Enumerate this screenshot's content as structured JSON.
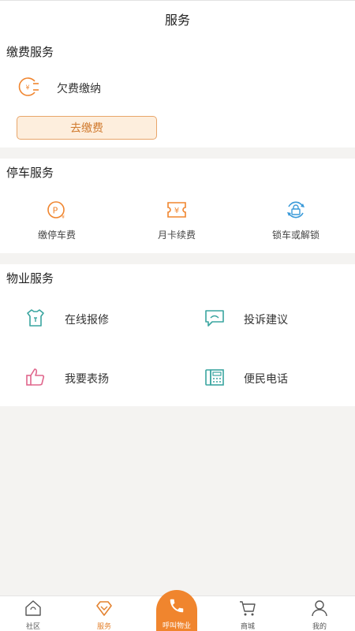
{
  "header": {
    "title": "服务"
  },
  "payment": {
    "title": "缴费服务",
    "arrears_label": "欠费缴纳",
    "pay_button": "去缴费"
  },
  "parking": {
    "title": "停车服务",
    "items": [
      {
        "label": "缴停车费",
        "icon": "parking-fee-icon"
      },
      {
        "label": "月卡续费",
        "icon": "ticket-icon"
      },
      {
        "label": "锁车或解锁",
        "icon": "car-lock-icon"
      }
    ]
  },
  "property": {
    "title": "物业服务",
    "items": [
      {
        "label": "在线报修",
        "icon": "repair-icon"
      },
      {
        "label": "投诉建议",
        "icon": "complaint-icon"
      },
      {
        "label": "我要表扬",
        "icon": "thumbs-up-icon"
      },
      {
        "label": "便民电话",
        "icon": "phone-directory-icon"
      }
    ]
  },
  "tabbar": {
    "items": [
      {
        "label": "社区",
        "icon": "home-icon"
      },
      {
        "label": "服务",
        "icon": "service-icon",
        "active": true
      },
      {
        "label": "呼叫物业",
        "icon": "phone-icon"
      },
      {
        "label": "商城",
        "icon": "cart-icon"
      },
      {
        "label": "我的",
        "icon": "user-icon"
      }
    ]
  },
  "colors": {
    "accent": "#f0852e",
    "teal": "#3aa5a0",
    "pink": "#e0668c",
    "blue": "#3a9ad9"
  }
}
